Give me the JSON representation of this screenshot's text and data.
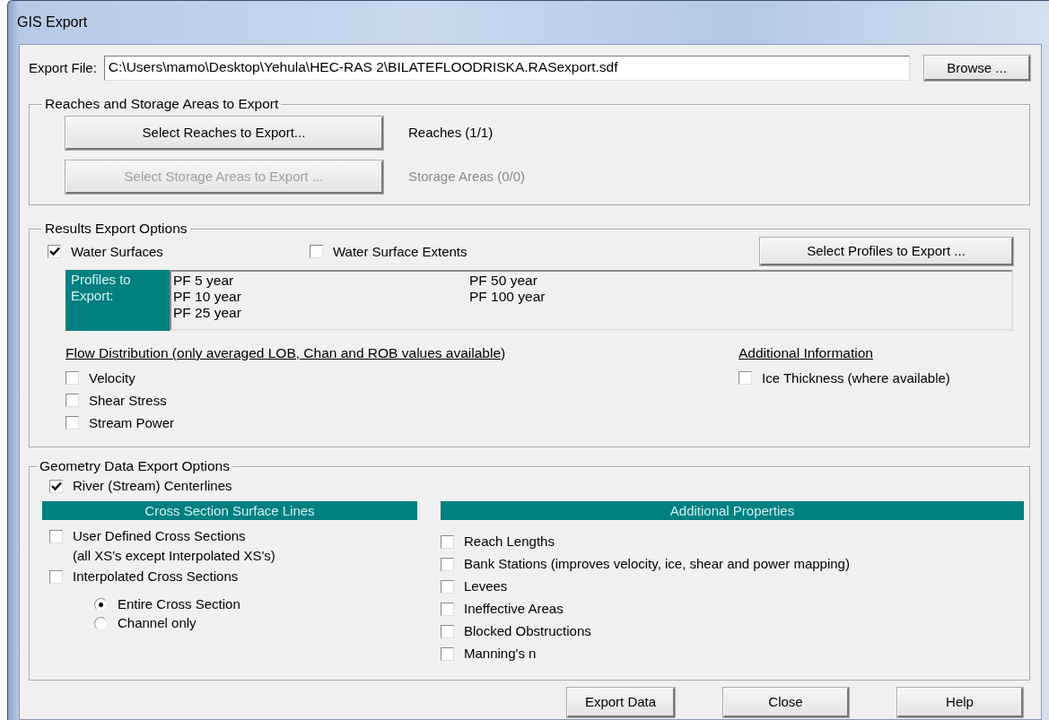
{
  "window": {
    "title": "GIS Export"
  },
  "export_file": {
    "label": "Export File:",
    "value": "C:\\Users\\mamo\\Desktop\\Yehula\\HEC-RAS 2\\BILATEFLOODRISKA.RASexport.sdf",
    "browse_button": "Browse ..."
  },
  "reaches_group": {
    "title": "Reaches and Storage Areas to Export",
    "rows": [
      {
        "button": "Select Reaches to Export...",
        "status": "Reaches (1/1)",
        "disabled": false
      },
      {
        "button": "Select Storage Areas to Export ...",
        "status": "Storage Areas (0/0)",
        "disabled": true
      }
    ]
  },
  "results_group": {
    "title": "Results Export Options",
    "options": [
      {
        "label": "Water Surfaces",
        "checked": true
      },
      {
        "label": "Water Surface Extents",
        "checked": false
      }
    ],
    "select_profiles_button": "Select Profiles to Export ...",
    "profiles_label": "Profiles to Export:",
    "profiles": [
      "PF 5 year",
      "PF 10 year",
      "PF 25 year",
      "PF 50 year",
      "PF 100 year"
    ],
    "flow_distribution": {
      "title": "Flow Distribution (only averaged LOB, Chan and ROB values available)",
      "items": [
        {
          "label": "Velocity",
          "checked": false
        },
        {
          "label": "Shear Stress",
          "checked": false
        },
        {
          "label": "Stream Power",
          "checked": false
        }
      ]
    },
    "additional_information": {
      "title": "Additional Information",
      "items": [
        {
          "label": "Ice Thickness (where available)",
          "checked": false
        }
      ]
    }
  },
  "geometry_group": {
    "title": "Geometry Data Export Options",
    "centerlines": {
      "label": "River (Stream) Centerlines",
      "checked": true
    },
    "cross_sections": {
      "title": "Cross Section Surface Lines",
      "items": [
        {
          "label": "User Defined Cross Sections",
          "note": "(all XS's except Interpolated XS's)",
          "checked": false
        },
        {
          "label": "Interpolated Cross Sections",
          "checked": false
        }
      ],
      "radios": [
        {
          "label": "Entire Cross Section",
          "selected": true
        },
        {
          "label": "Channel only",
          "selected": false
        }
      ]
    },
    "additional_properties": {
      "title": "Additional Properties",
      "items": [
        {
          "label": "Reach Lengths",
          "checked": false
        },
        {
          "label": "Bank Stations (improves velocity, ice, shear and power mapping)",
          "checked": false
        },
        {
          "label": "Levees",
          "checked": false
        },
        {
          "label": "Ineffective Areas",
          "checked": false
        },
        {
          "label": "Blocked Obstructions",
          "checked": false
        },
        {
          "label": "Manning's n",
          "checked": false
        }
      ]
    }
  },
  "buttons": [
    "Export Data",
    "Close",
    "Help"
  ]
}
